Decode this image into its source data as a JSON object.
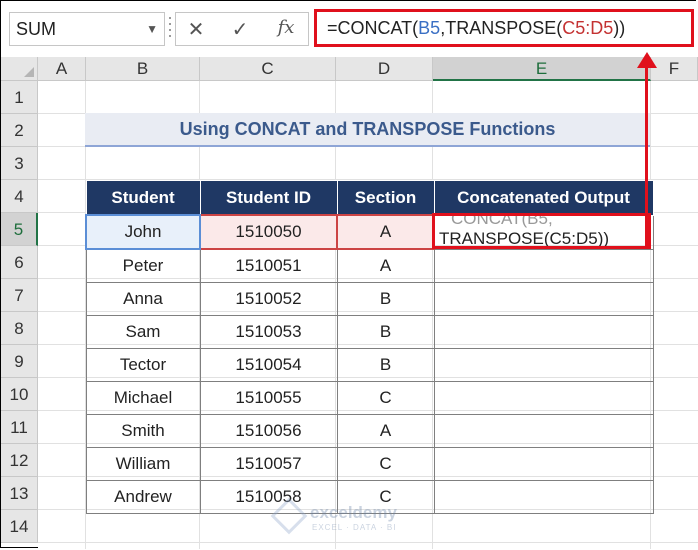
{
  "formula_bar": {
    "name_box": "SUM",
    "cancel_glyph": "✕",
    "enter_glyph": "✓",
    "fx_glyph": "fx",
    "formula_prefix": "=CONCAT(",
    "formula_ref1": "B5",
    "formula_mid": ",TRANSPOSE(",
    "formula_ref2": "C5:D5",
    "formula_suffix": "))"
  },
  "columns": [
    "A",
    "B",
    "C",
    "D",
    "E",
    "F"
  ],
  "rows": [
    "1",
    "2",
    "3",
    "4",
    "5",
    "6",
    "7",
    "8",
    "9",
    "10",
    "11",
    "12",
    "13",
    "14"
  ],
  "title": "Using CONCAT and TRANSPOSE Functions",
  "table": {
    "headers": [
      "Student",
      "Student ID",
      "Section",
      "Concatenated Output"
    ],
    "rows": [
      [
        "John",
        "1510050",
        "A",
        ""
      ],
      [
        "Peter",
        "1510051",
        "A",
        ""
      ],
      [
        "Anna",
        "1510052",
        "B",
        ""
      ],
      [
        "Sam",
        "1510053",
        "B",
        ""
      ],
      [
        "Tector",
        "1510054",
        "B",
        ""
      ],
      [
        "Michael",
        "1510055",
        "C",
        ""
      ],
      [
        "Smith",
        "1510056",
        "A",
        ""
      ],
      [
        "William",
        "1510057",
        "C",
        ""
      ],
      [
        "Andrew",
        "1510058",
        "C",
        ""
      ]
    ],
    "edit_ghost": "CONCAT(B5,",
    "edit_text": "TRANSPOSE(C5:D5))"
  },
  "watermark": {
    "name": "exceldemy",
    "sub": "EXCEL · DATA · BI"
  },
  "colors": {
    "accent_red": "#e0101c",
    "header_navy": "#1f3864",
    "excel_green": "#217346"
  }
}
